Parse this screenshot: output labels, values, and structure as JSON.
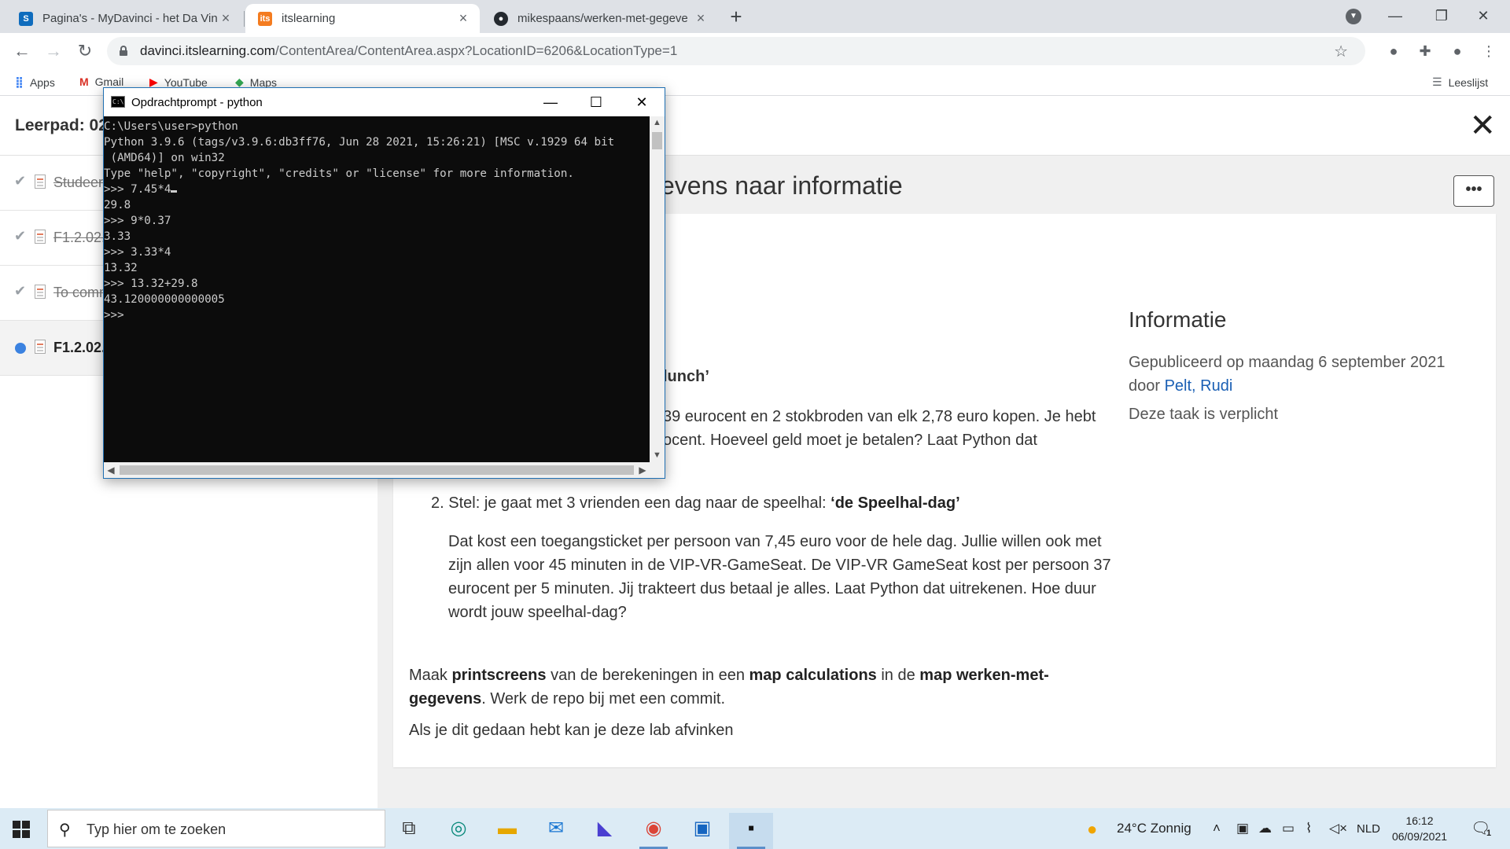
{
  "browser": {
    "tabs": [
      {
        "title": "Pagina's - MyDavinci - het Da Vin",
        "icon": "sharepoint-icon",
        "active": false
      },
      {
        "title": "itslearning",
        "icon": "itslearning-icon",
        "active": true
      },
      {
        "title": "mikespaans/werken-met-gegeve",
        "icon": "github-icon",
        "active": false
      }
    ],
    "url_host": "davinci.itslearning.com",
    "url_path": "/ContentArea/ContentArea.aspx?LocationID=6206&LocationType=1",
    "bookmarks": [
      {
        "label": "Apps",
        "icon": "apps-grid-icon"
      },
      {
        "label": "Gmail",
        "icon": "gmail-icon"
      },
      {
        "label": "YouTube",
        "icon": "youtube-icon"
      },
      {
        "label": "Maps",
        "icon": "maps-icon"
      }
    ],
    "reading_list": "Leeslijst"
  },
  "page": {
    "leerpad": "Leerpad: 02",
    "title_visible": "evens naar informatie",
    "sidebar": [
      {
        "label": "Studeer",
        "done": true
      },
      {
        "label": "F1.2.02.",
        "done": true
      },
      {
        "label": "To comm",
        "done": true
      },
      {
        "label": "F1.2.02.",
        "done": false
      }
    ],
    "content": {
      "q1_heading_fragment": "lunch’",
      "q1_line1_fragment": "39 eurocent en 2 stokbroden van elk 2,78 euro kopen. Je hebt",
      "q1_line2_fragment": "ocent. Hoeveel geld moet je betalen? Laat Python dat",
      "q2_number": "2.",
      "q2_lead": "Stel: je gaat met 3 vrienden een dag naar de speelhal: ",
      "q2_title": "‘de Speelhal-dag’",
      "q2_body": "Dat kost een toegangsticket per persoon van 7,45 euro voor de hele dag. Jullie willen ook met zijn allen voor 45 minuten in de VIP-VR-GameSeat. De VIP-VR GameSeat kost per persoon 37 eurocent per 5 minuten. Jij trakteert dus betaal je alles. Laat Python dat uitrekenen. Hoe duur wordt jouw speelhal-dag?",
      "instr_p1": "Maak ",
      "instr_b1": "printscreens",
      "instr_p2": " van de berekeningen in een ",
      "instr_b2": "map calculations",
      "instr_p3": " in de ",
      "instr_b3": "map werken-met-gegevens",
      "instr_p4": ". Werk de repo bij met een commit.",
      "closing": "Als je dit gedaan hebt kan je deze lab afvinken"
    },
    "info": {
      "title": "Informatie",
      "published": "Gepubliceerd op maandag 6 september 2021",
      "by_label": "door ",
      "author": "Pelt, Rudi",
      "required": "Deze taak is verplicht"
    }
  },
  "console": {
    "title": "Opdrachtprompt - python",
    "lines": [
      "C:\\Users\\user>python",
      "Python 3.9.6 (tags/v3.9.6:db3ff76, Jun 28 2021, 15:26:21) [MSC v.1929 64 bit",
      " (AMD64)] on win32",
      "Type \"help\", \"copyright\", \"credits\" or \"license\" for more information.",
      ">>> 7.45*4",
      "29.8",
      ">>> 9*0.37",
      "3.33",
      ">>> 3.33*4",
      "13.32",
      ">>> 13.32+29.8",
      "43.120000000000005",
      ">>>"
    ]
  },
  "taskbar": {
    "search_placeholder": "Typ hier om te zoeken",
    "weather": "24°C  Zonnig",
    "language": "NLD",
    "time": "16:12",
    "date": "06/09/2021",
    "notification_count": "1"
  },
  "colors": {
    "accent_link": "#1a5fb4",
    "sidebar_current_dot": "#3b82e0",
    "console_bg": "#0c0c0c",
    "taskbar_bg": "#dcebf5"
  }
}
